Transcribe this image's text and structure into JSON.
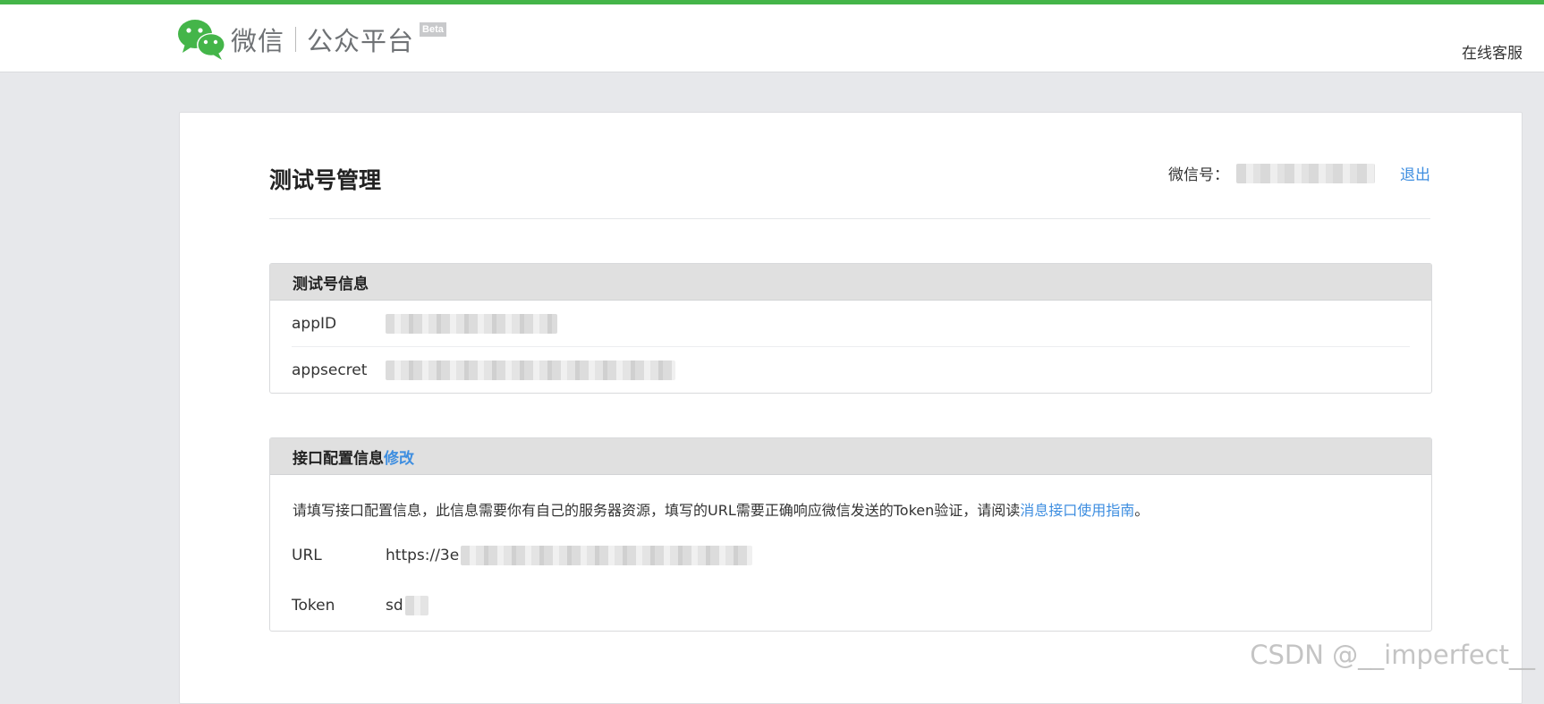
{
  "header": {
    "brand_name": "微信",
    "brand_platform": "公众平台",
    "beta": "Beta",
    "help_link": "在线客服"
  },
  "page": {
    "title": "测试号管理",
    "account_label": "微信号：",
    "logout": "退出"
  },
  "test_account": {
    "title": "测试号信息",
    "rows": [
      {
        "label": "appID"
      },
      {
        "label": "appsecret"
      }
    ]
  },
  "interface": {
    "title": "接口配置信息",
    "edit": "修改",
    "desc_prefix": "请填写接口配置信息，此信息需要你有自己的服务器资源，填写的URL需要正确响应微信发送的Token验证，请阅读",
    "desc_link": "消息接口使用指南",
    "desc_suffix": "。",
    "url_label": "URL",
    "url_value": "https://3e",
    "token_label": "Token",
    "token_value": "sd"
  },
  "watermark": "CSDN @__imperfect__",
  "colors": {
    "accent_green": "#44b549",
    "link_blue": "#3e8ee0",
    "page_bg": "#e7e8eb"
  }
}
